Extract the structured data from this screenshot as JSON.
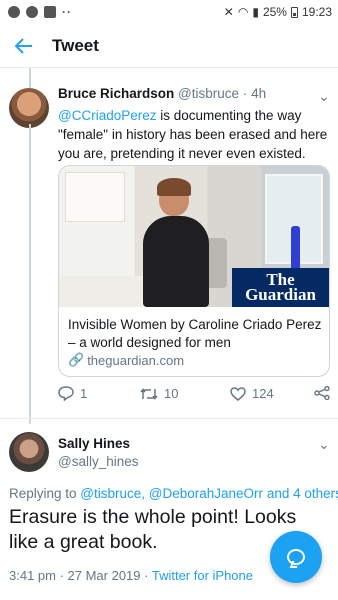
{
  "statusbar": {
    "battery": "25%",
    "time": "19:23",
    "dots": "··"
  },
  "header": {
    "back_icon": "arrow-left-icon",
    "title": "Tweet"
  },
  "parent_tweet": {
    "name": "Bruce Richardson",
    "handle": "@tisbruce",
    "separator": "·",
    "time": "4h",
    "mention": "@CCriadoPerez",
    "text": " is documenting the way \"female\" in history has been erased and here you are, pretending it never even existed.",
    "card": {
      "image_logo_line1": "The",
      "image_logo_line2": "Guardian",
      "title": "Invisible Women by Caroline Criado Perez – a world designed for men",
      "domain": "theguardian.com"
    },
    "actions": {
      "replies": "1",
      "retweets": "10",
      "likes": "124"
    }
  },
  "main_tweet": {
    "name": "Sally Hines",
    "handle": "@sally_hines",
    "replying_prefix": "Replying to ",
    "replying_to_1": "@tisbruce",
    "replying_sep": ", ",
    "replying_to_2": "@DeborahJaneOrr",
    "replying_suffix": " and 4 others",
    "text": "Erasure is the whole point! Looks like a great book.",
    "timestamp": "3:41 pm · 27 Mar 2019 · ",
    "source": "Twitter for iPhone"
  },
  "colors": {
    "accent": "#1da1f2",
    "muted": "#657786",
    "guardian": "#052962"
  }
}
